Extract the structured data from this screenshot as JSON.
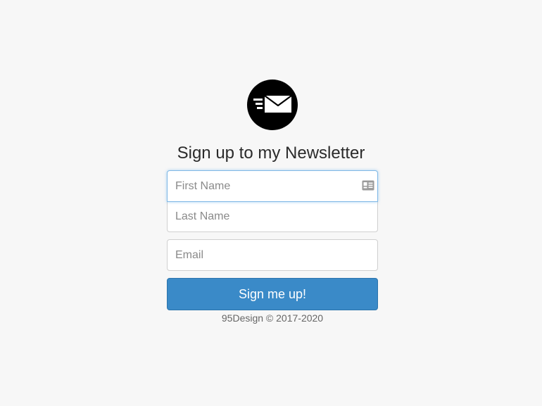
{
  "logo": {
    "icon": "newsletter-envelope-icon"
  },
  "form": {
    "title": "Sign up to my Newsletter",
    "first_name": {
      "placeholder": "First Name",
      "value": "",
      "icon": "contact-card-icon"
    },
    "last_name": {
      "placeholder": "Last Name",
      "value": ""
    },
    "email": {
      "placeholder": "Email",
      "value": ""
    },
    "submit_label": "Sign me up!"
  },
  "footer": {
    "text": "95Design © 2017-2020"
  },
  "colors": {
    "background": "#f7f7f7",
    "button": "#3a8ac8",
    "focus_border": "#7fb8e6",
    "logo": "#000000"
  }
}
